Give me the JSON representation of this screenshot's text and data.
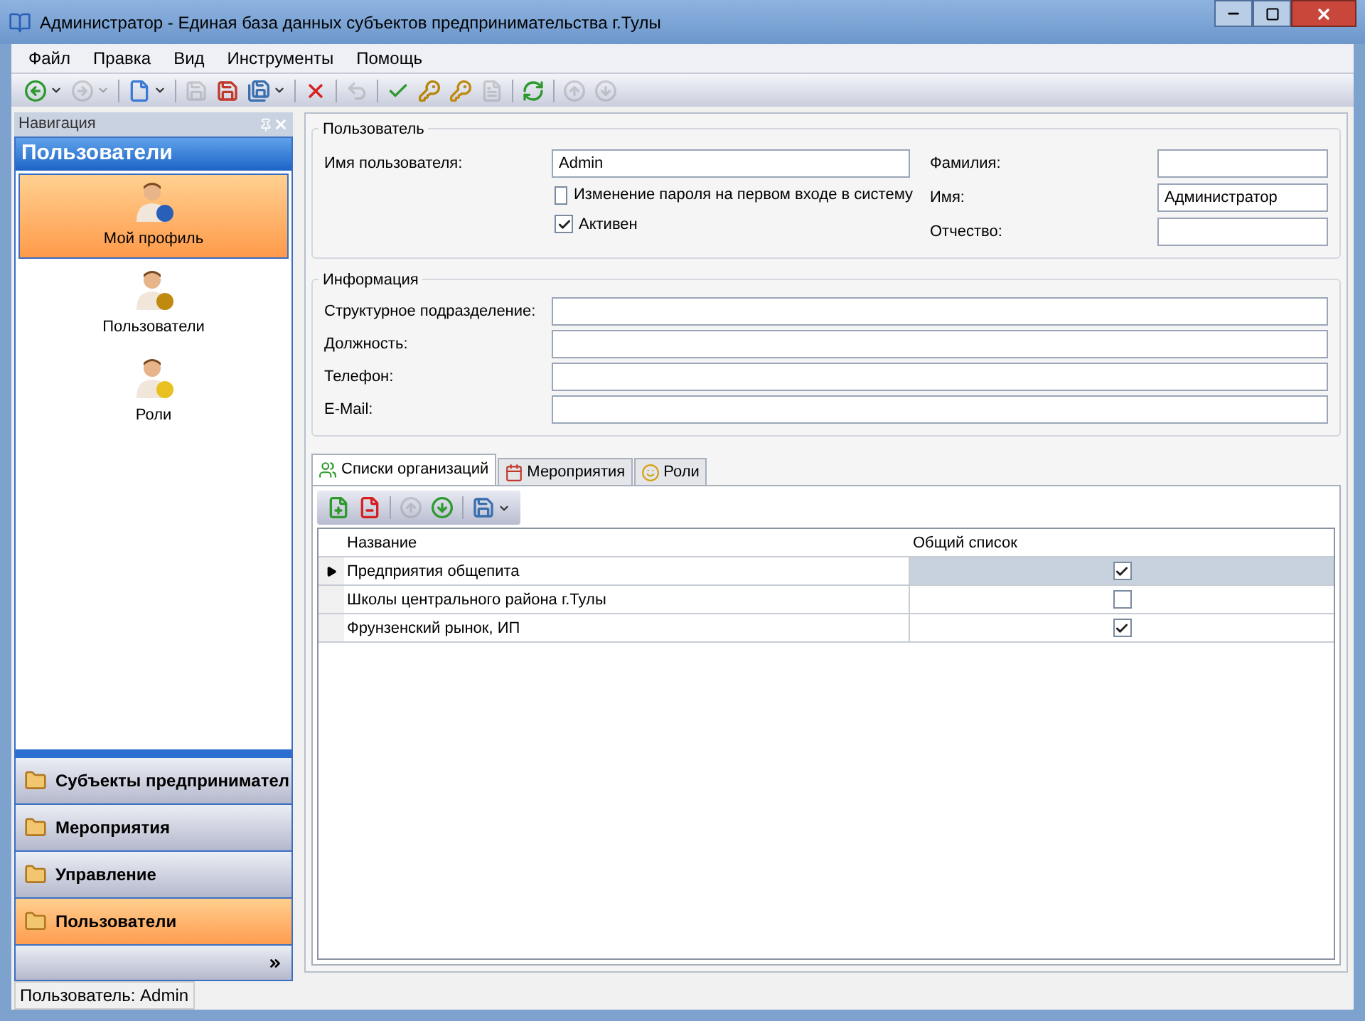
{
  "window": {
    "title": "Администратор - Единая база данных субъектов предпринимательства г.Тулы"
  },
  "menu": [
    "Файл",
    "Правка",
    "Вид",
    "Инструменты",
    "Помощь"
  ],
  "toolbar": [
    {
      "kind": "button",
      "disabled": false,
      "dropdown": true
    },
    {
      "kind": "button",
      "disabled": true,
      "dropdown": true
    },
    {
      "kind": "separator"
    },
    {
      "kind": "button",
      "disabled": false,
      "dropdown": true
    },
    {
      "kind": "separator"
    },
    {
      "kind": "button",
      "disabled": true
    },
    {
      "kind": "button",
      "disabled": false
    },
    {
      "kind": "button",
      "disabled": false,
      "dropdown": true
    },
    {
      "kind": "separator"
    },
    {
      "kind": "button",
      "disabled": false
    },
    {
      "kind": "separator"
    },
    {
      "kind": "button",
      "disabled": true
    },
    {
      "kind": "separator"
    },
    {
      "kind": "button",
      "disabled": false
    },
    {
      "kind": "button",
      "disabled": false
    },
    {
      "kind": "button",
      "disabled": false
    },
    {
      "kind": "button",
      "disabled": true
    },
    {
      "kind": "separator"
    },
    {
      "kind": "button",
      "disabled": false
    },
    {
      "kind": "separator"
    },
    {
      "kind": "button",
      "disabled": true
    },
    {
      "kind": "button",
      "disabled": true
    }
  ],
  "navigation": {
    "title": "Навигация",
    "section": "Пользователи",
    "items": [
      {
        "label": "Мой профиль",
        "selected": true
      },
      {
        "label": "Пользователи",
        "selected": false
      },
      {
        "label": "Роли",
        "selected": false
      }
    ],
    "groups": [
      {
        "label": "Субъекты предпринимател",
        "selected": false
      },
      {
        "label": "Мероприятия",
        "selected": false
      },
      {
        "label": "Управление",
        "selected": false
      },
      {
        "label": "Пользователи",
        "selected": true
      }
    ]
  },
  "user_group": {
    "title": "Пользователь",
    "username": {
      "label": "Имя пользователя:",
      "value": "Admin"
    },
    "checkboxes": [
      {
        "label": "Изменение пароля на первом входе в систему",
        "checked": false
      },
      {
        "label": "Активен",
        "checked": true
      }
    ],
    "name_fields": [
      {
        "label": "Фамилия:"
      },
      {
        "label": "Имя:",
        "value": "Администратор"
      },
      {
        "label": "Отчество:"
      }
    ]
  },
  "info_group": {
    "title": "Информация",
    "fields": [
      {
        "label": "Структурное подразделение:"
      },
      {
        "label": "Должность:"
      },
      {
        "label": "Телефон:"
      },
      {
        "label": "E-Mail:"
      }
    ]
  },
  "tabs": [
    {
      "label": "Списки организаций",
      "selected": true
    },
    {
      "label": "Мероприятия",
      "selected": false
    },
    {
      "label": "Роли",
      "selected": false
    }
  ],
  "grid_toolbar": [
    {
      "kind": "button",
      "disabled": false
    },
    {
      "kind": "button",
      "disabled": false
    },
    {
      "kind": "separator"
    },
    {
      "kind": "button",
      "disabled": true
    },
    {
      "kind": "button",
      "disabled": false
    },
    {
      "kind": "separator"
    },
    {
      "kind": "button",
      "disabled": false,
      "dropdown": true
    }
  ],
  "table": {
    "columns": [
      "Название",
      "Общий список"
    ],
    "rows": [
      {
        "name": "Предприятия общепита",
        "shared": true,
        "selected": true
      },
      {
        "name": "Школы центрального района г.Тулы",
        "shared": false,
        "selected": false
      },
      {
        "name": "Фрунзенский рынок, ИП",
        "shared": true,
        "selected": false
      }
    ]
  },
  "status_bar": "Пользователь: Admin"
}
